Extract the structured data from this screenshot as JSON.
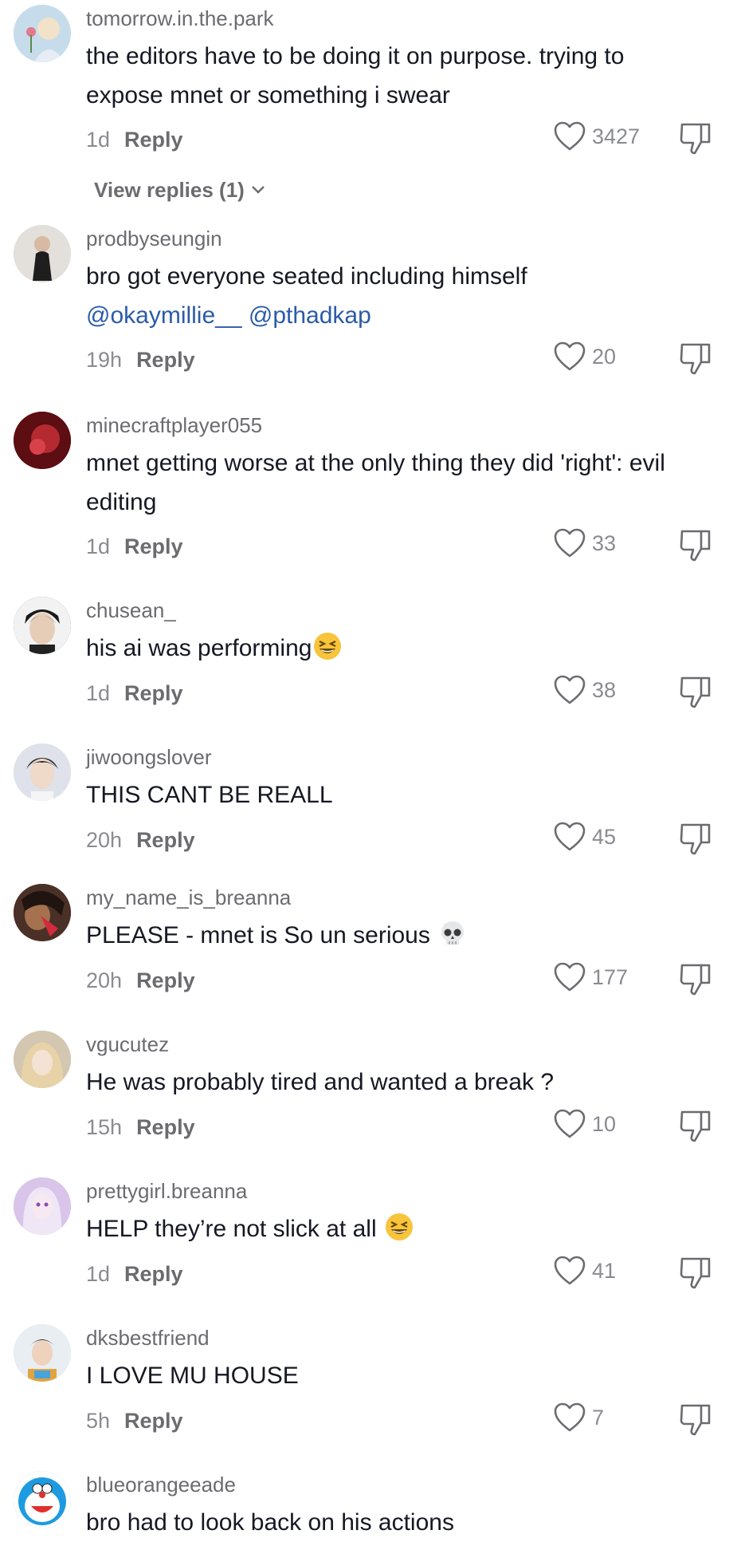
{
  "comments": [
    {
      "username": "tomorrow.in.the.park",
      "text": "the editors have to be doing it on purpose. trying to expose mnet or something i swear",
      "time": "1d",
      "reply": "Reply",
      "likes": "3427",
      "avatar_color": "#b8d4e6"
    },
    {
      "username": "prodbyseungin",
      "text": "bro got everyone seated including himself",
      "mentions": "@okaymillie__ @pthadkap",
      "time": "19h",
      "reply": "Reply",
      "likes": "20",
      "avatar_color": "#d9d4cf"
    },
    {
      "username": "minecraftplayer055",
      "text": "mnet getting worse at the only thing they did 'right': evil editing",
      "time": "1d",
      "reply": "Reply",
      "likes": "33",
      "avatar_color": "#7a1418"
    },
    {
      "username": "chusean_",
      "text": "his ai was performing",
      "time": "1d",
      "reply": "Reply",
      "likes": "38",
      "avatar_color": "#3a3a3a"
    },
    {
      "username": "jiwoongslover",
      "text": "THIS CANT BE REALL",
      "time": "20h",
      "reply": "Reply",
      "likes": "45",
      "avatar_color": "#c9ccd6"
    },
    {
      "username": "my_name_is_breanna",
      "text": "PLEASE - mnet is So un serious",
      "time": "20h",
      "reply": "Reply",
      "likes": "177",
      "avatar_color": "#5a3a2c"
    },
    {
      "username": "vgucutez",
      "text": "He was probably tired and wanted a break ?",
      "time": "15h",
      "reply": "Reply",
      "likes": "10",
      "avatar_color": "#cbbfa8"
    },
    {
      "username": "prettygirl.breanna",
      "text": "HELP they’re not slick at all",
      "time": "1d",
      "reply": "Reply",
      "likes": "41",
      "avatar_color": "#cdb3e0"
    },
    {
      "username": "dksbestfriend",
      "text": "I LOVE MU HOUSE",
      "time": "5h",
      "reply": "Reply",
      "likes": "7",
      "avatar_color": "#b9c9d2"
    },
    {
      "username": "blueorangeeade",
      "text": "bro had to look back on his actions",
      "avatar_color": "#3aa7e0"
    }
  ],
  "view_replies": "View replies (1)",
  "icons": {
    "like": "heart-outline-icon",
    "dislike": "thumbs-down-icon",
    "emoji_laugh": "grinning-squinting-face-icon",
    "emoji_skull": "skull-icon"
  },
  "colors": {
    "mention": "#2b5ba8",
    "meta": "#8a8b91",
    "username": "#6b6b70"
  }
}
